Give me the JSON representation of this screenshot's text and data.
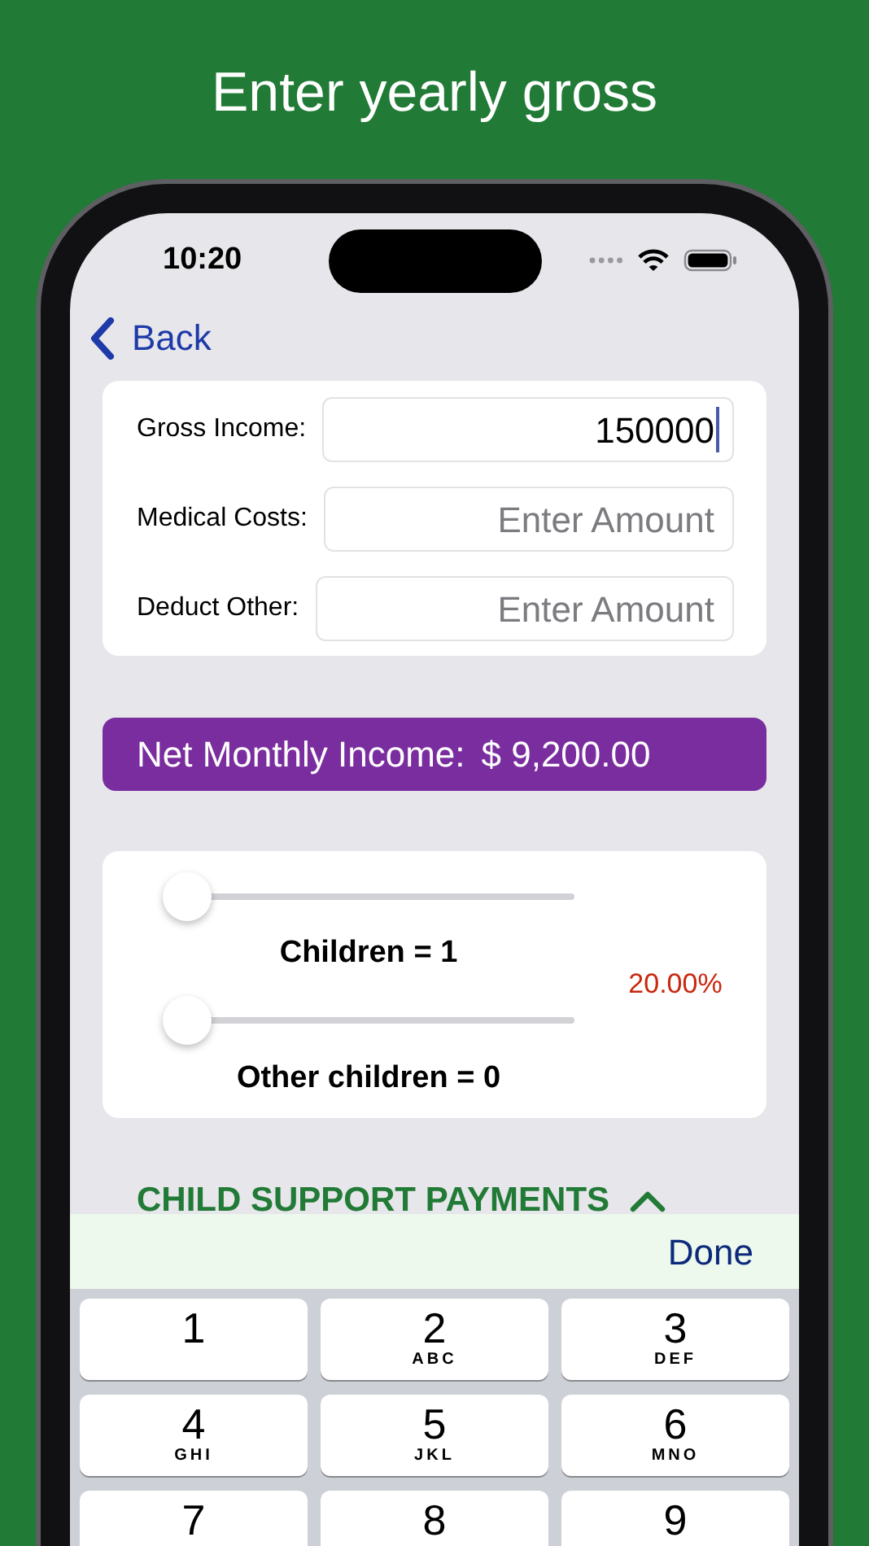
{
  "headline": "Enter yearly gross",
  "status_bar": {
    "time": "10:20"
  },
  "nav": {
    "back": "Back"
  },
  "fields": [
    {
      "label": "Gross Income:",
      "value": "150000",
      "focused": true
    },
    {
      "label": "Medical Costs:",
      "placeholder": "Enter Amount",
      "focused": false
    },
    {
      "label": "Deduct Other:",
      "placeholder": "Enter Amount",
      "focused": false
    }
  ],
  "net_income": {
    "label": "Net Monthly Income:",
    "value": "$ 9,200.00"
  },
  "sliders": [
    {
      "label": "Children = 1",
      "level": 0
    },
    {
      "label": "Other children = 0",
      "level": 0
    }
  ],
  "percentage": "20.00%",
  "section": {
    "title": "CHILD SUPPORT PAYMENTS",
    "expanded": true
  },
  "keyboard": {
    "done": "Done",
    "keys": [
      {
        "digit": "1"
      },
      {
        "digit": "2",
        "letters": "ABC"
      },
      {
        "digit": "3",
        "letters": "DEF"
      },
      {
        "digit": "4",
        "letters": "GHI"
      },
      {
        "digit": "5",
        "letters": "JKL"
      },
      {
        "digit": "6",
        "letters": "MNO"
      },
      {
        "digit": "7"
      },
      {
        "digit": "8"
      },
      {
        "digit": "9"
      }
    ]
  }
}
